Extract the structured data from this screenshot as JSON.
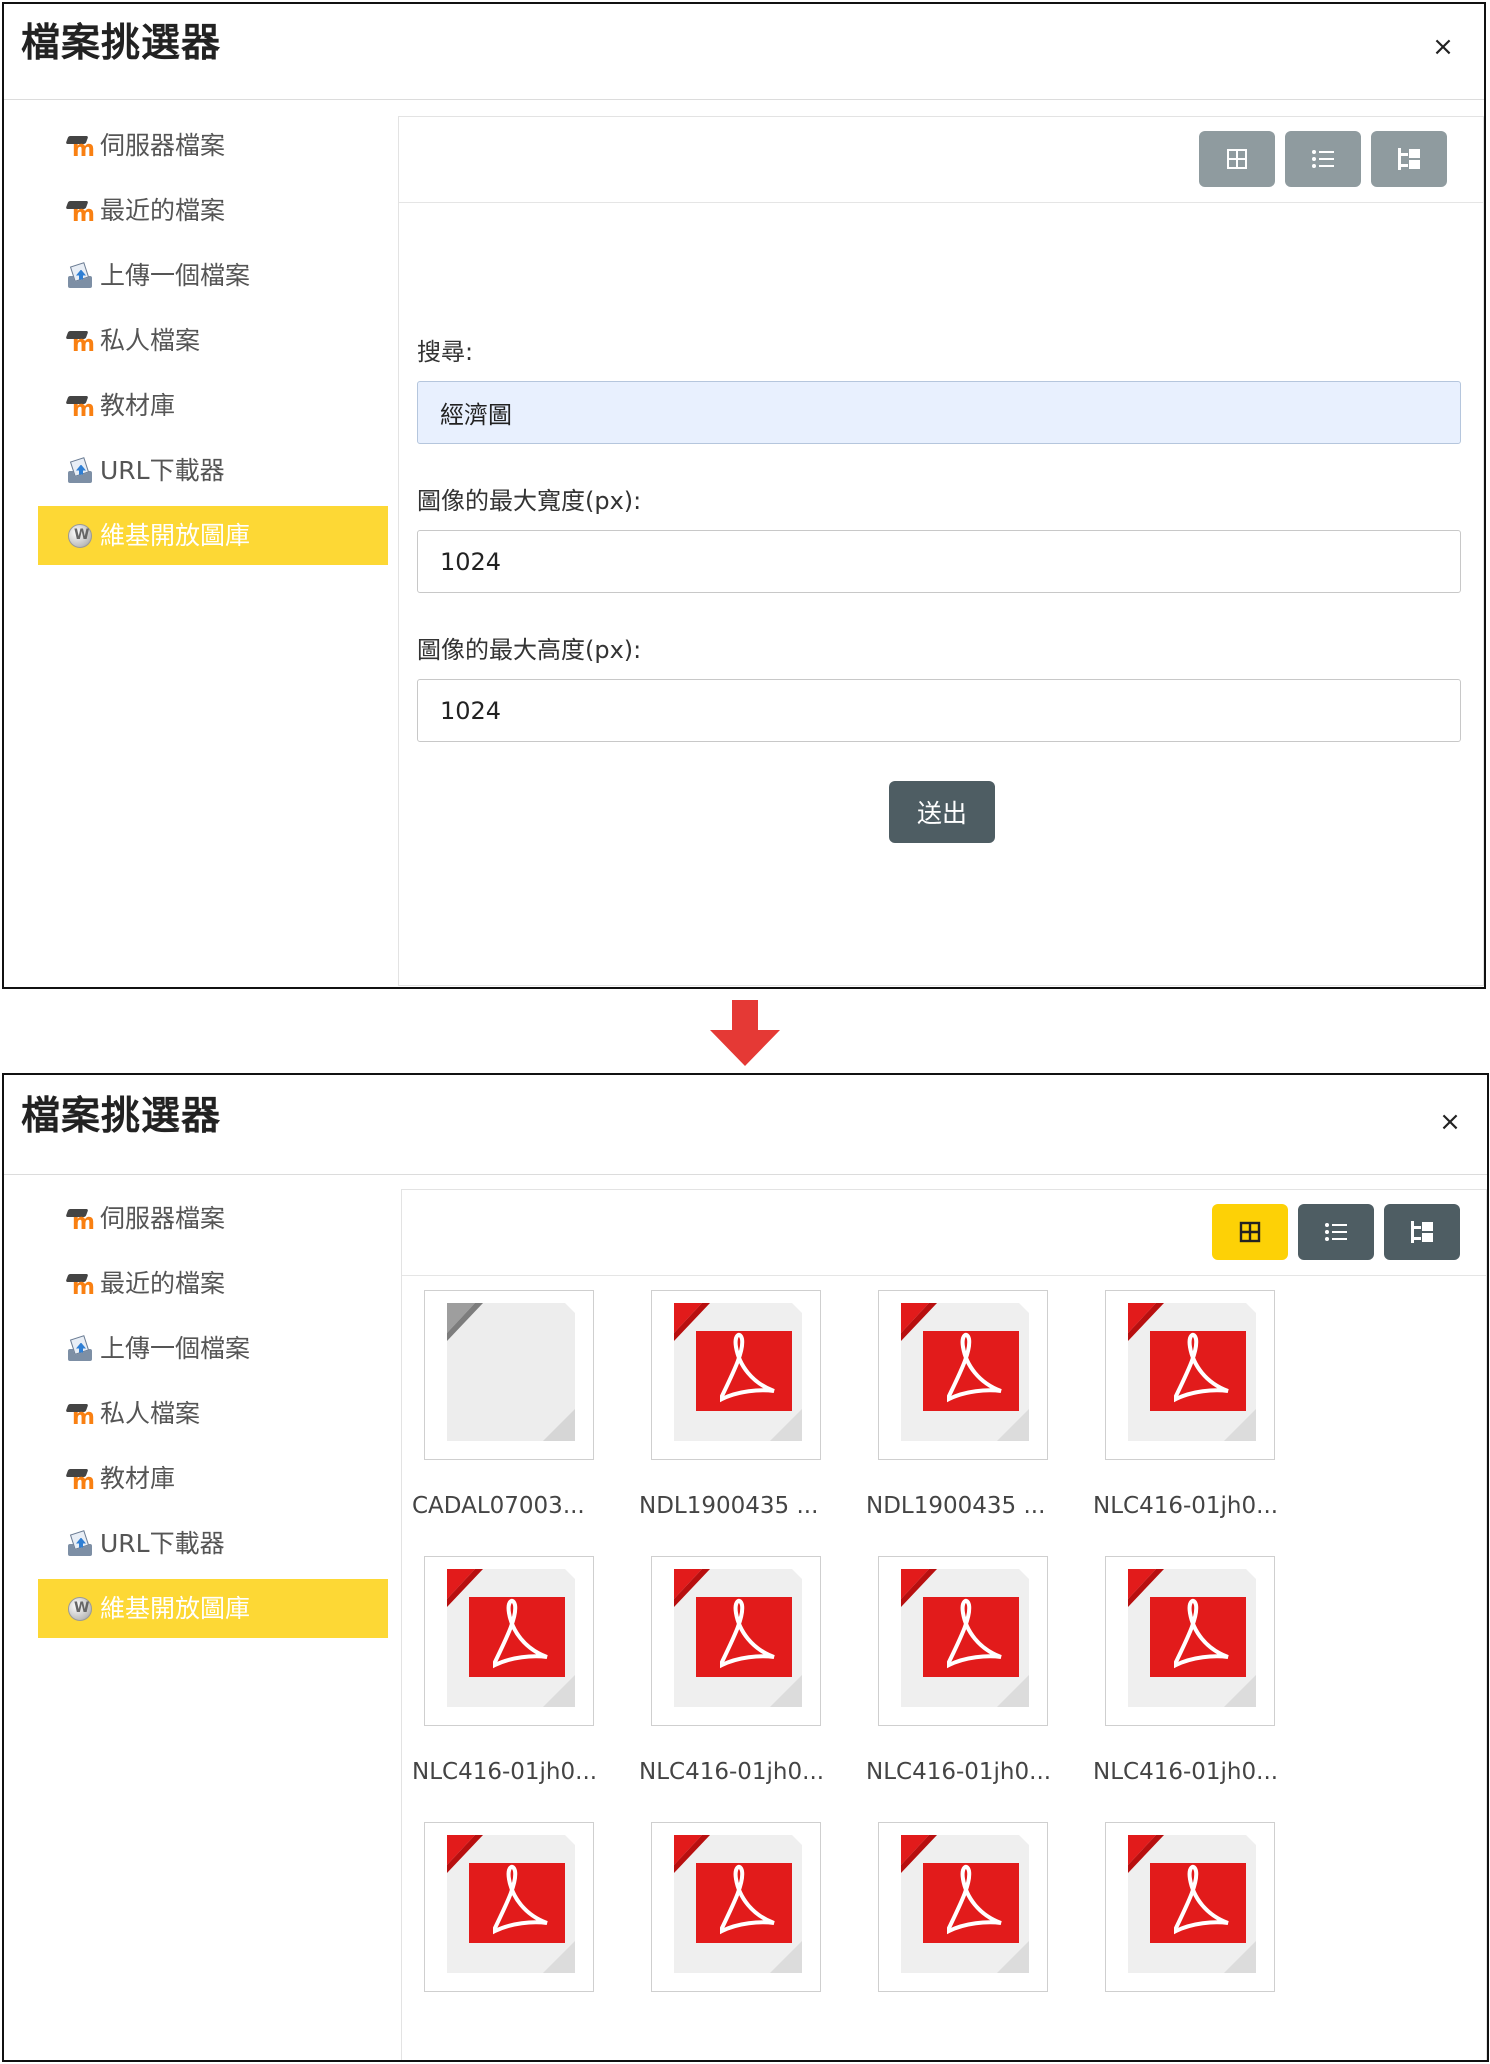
{
  "dialog_title": "檔案挑選器",
  "close_label": "×",
  "sidebar": {
    "items": [
      {
        "label": "伺服器檔案",
        "icon": "moodle-icon"
      },
      {
        "label": "最近的檔案",
        "icon": "moodle-icon"
      },
      {
        "label": "上傳一個檔案",
        "icon": "upload-icon"
      },
      {
        "label": "私人檔案",
        "icon": "moodle-icon"
      },
      {
        "label": "教材庫",
        "icon": "moodle-icon"
      },
      {
        "label": "URL下載器",
        "icon": "upload-icon"
      },
      {
        "label": "維基開放圖庫",
        "icon": "wiki-globe-icon"
      }
    ],
    "active_index": 6,
    "active_color": "#fdd835"
  },
  "view_buttons": [
    "grid-view-icon",
    "list-view-icon",
    "tree-view-icon"
  ],
  "search_form": {
    "search_label": "搜尋:",
    "search_value": "經濟圖",
    "max_width_label": "圖像的最大寬度(px):",
    "max_width_value": "1024",
    "max_height_label": "圖像的最大高度(px):",
    "max_height_value": "1024",
    "submit_label": "送出"
  },
  "results": {
    "files": [
      {
        "name": "CADAL07003...",
        "type": "generic"
      },
      {
        "name": "NDL1900435 ...",
        "type": "pdf"
      },
      {
        "name": "NDL1900435 ...",
        "type": "pdf"
      },
      {
        "name": "NLC416-01jh0...",
        "type": "pdf"
      },
      {
        "name": "NLC416-01jh0...",
        "type": "pdf"
      },
      {
        "name": "NLC416-01jh0...",
        "type": "pdf"
      },
      {
        "name": "NLC416-01jh0...",
        "type": "pdf"
      },
      {
        "name": "NLC416-01jh0...",
        "type": "pdf"
      },
      {
        "name": "",
        "type": "pdf"
      },
      {
        "name": "",
        "type": "pdf"
      },
      {
        "name": "",
        "type": "pdf"
      },
      {
        "name": "",
        "type": "pdf"
      }
    ]
  },
  "colors": {
    "button_gray": "#8f9b9f",
    "button_dark": "#4e5d63",
    "button_active": "#fdd106",
    "arrow": "#e53935",
    "pdf_red": "#e21b1b"
  }
}
